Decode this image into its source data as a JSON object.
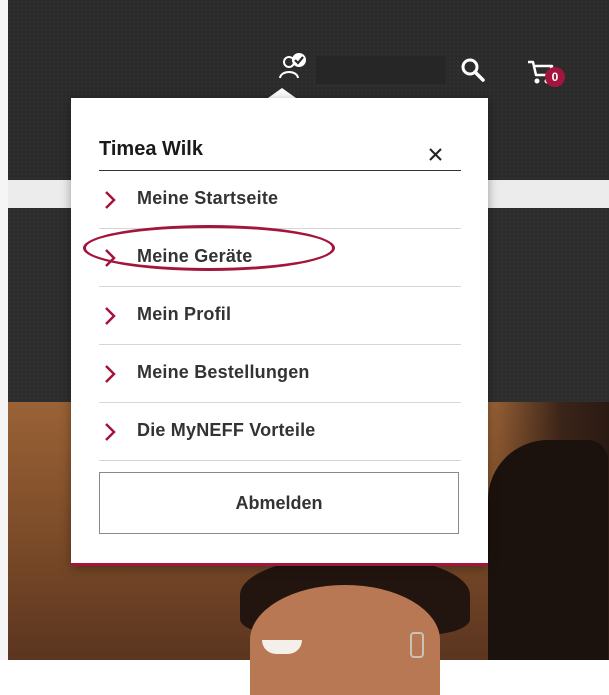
{
  "header": {
    "user_icon": "user-check-icon",
    "search_icon": "search-icon",
    "cart_icon": "cart-icon",
    "cart_count": "0",
    "accent_color": "#a3153c"
  },
  "account_menu": {
    "user_name": "Timea Wilk",
    "close_icon": "close-icon",
    "items": [
      {
        "label": "Meine Startseite",
        "icon": "chevron-right-icon"
      },
      {
        "label": "Meine Geräte",
        "icon": "chevron-right-icon",
        "highlighted": true
      },
      {
        "label": "Mein Profil",
        "icon": "chevron-right-icon"
      },
      {
        "label": "Meine Bestellungen",
        "icon": "chevron-right-icon"
      },
      {
        "label": "Die MyNEFF Vorteile",
        "icon": "chevron-right-icon"
      }
    ],
    "logout_label": "Abmelden"
  }
}
